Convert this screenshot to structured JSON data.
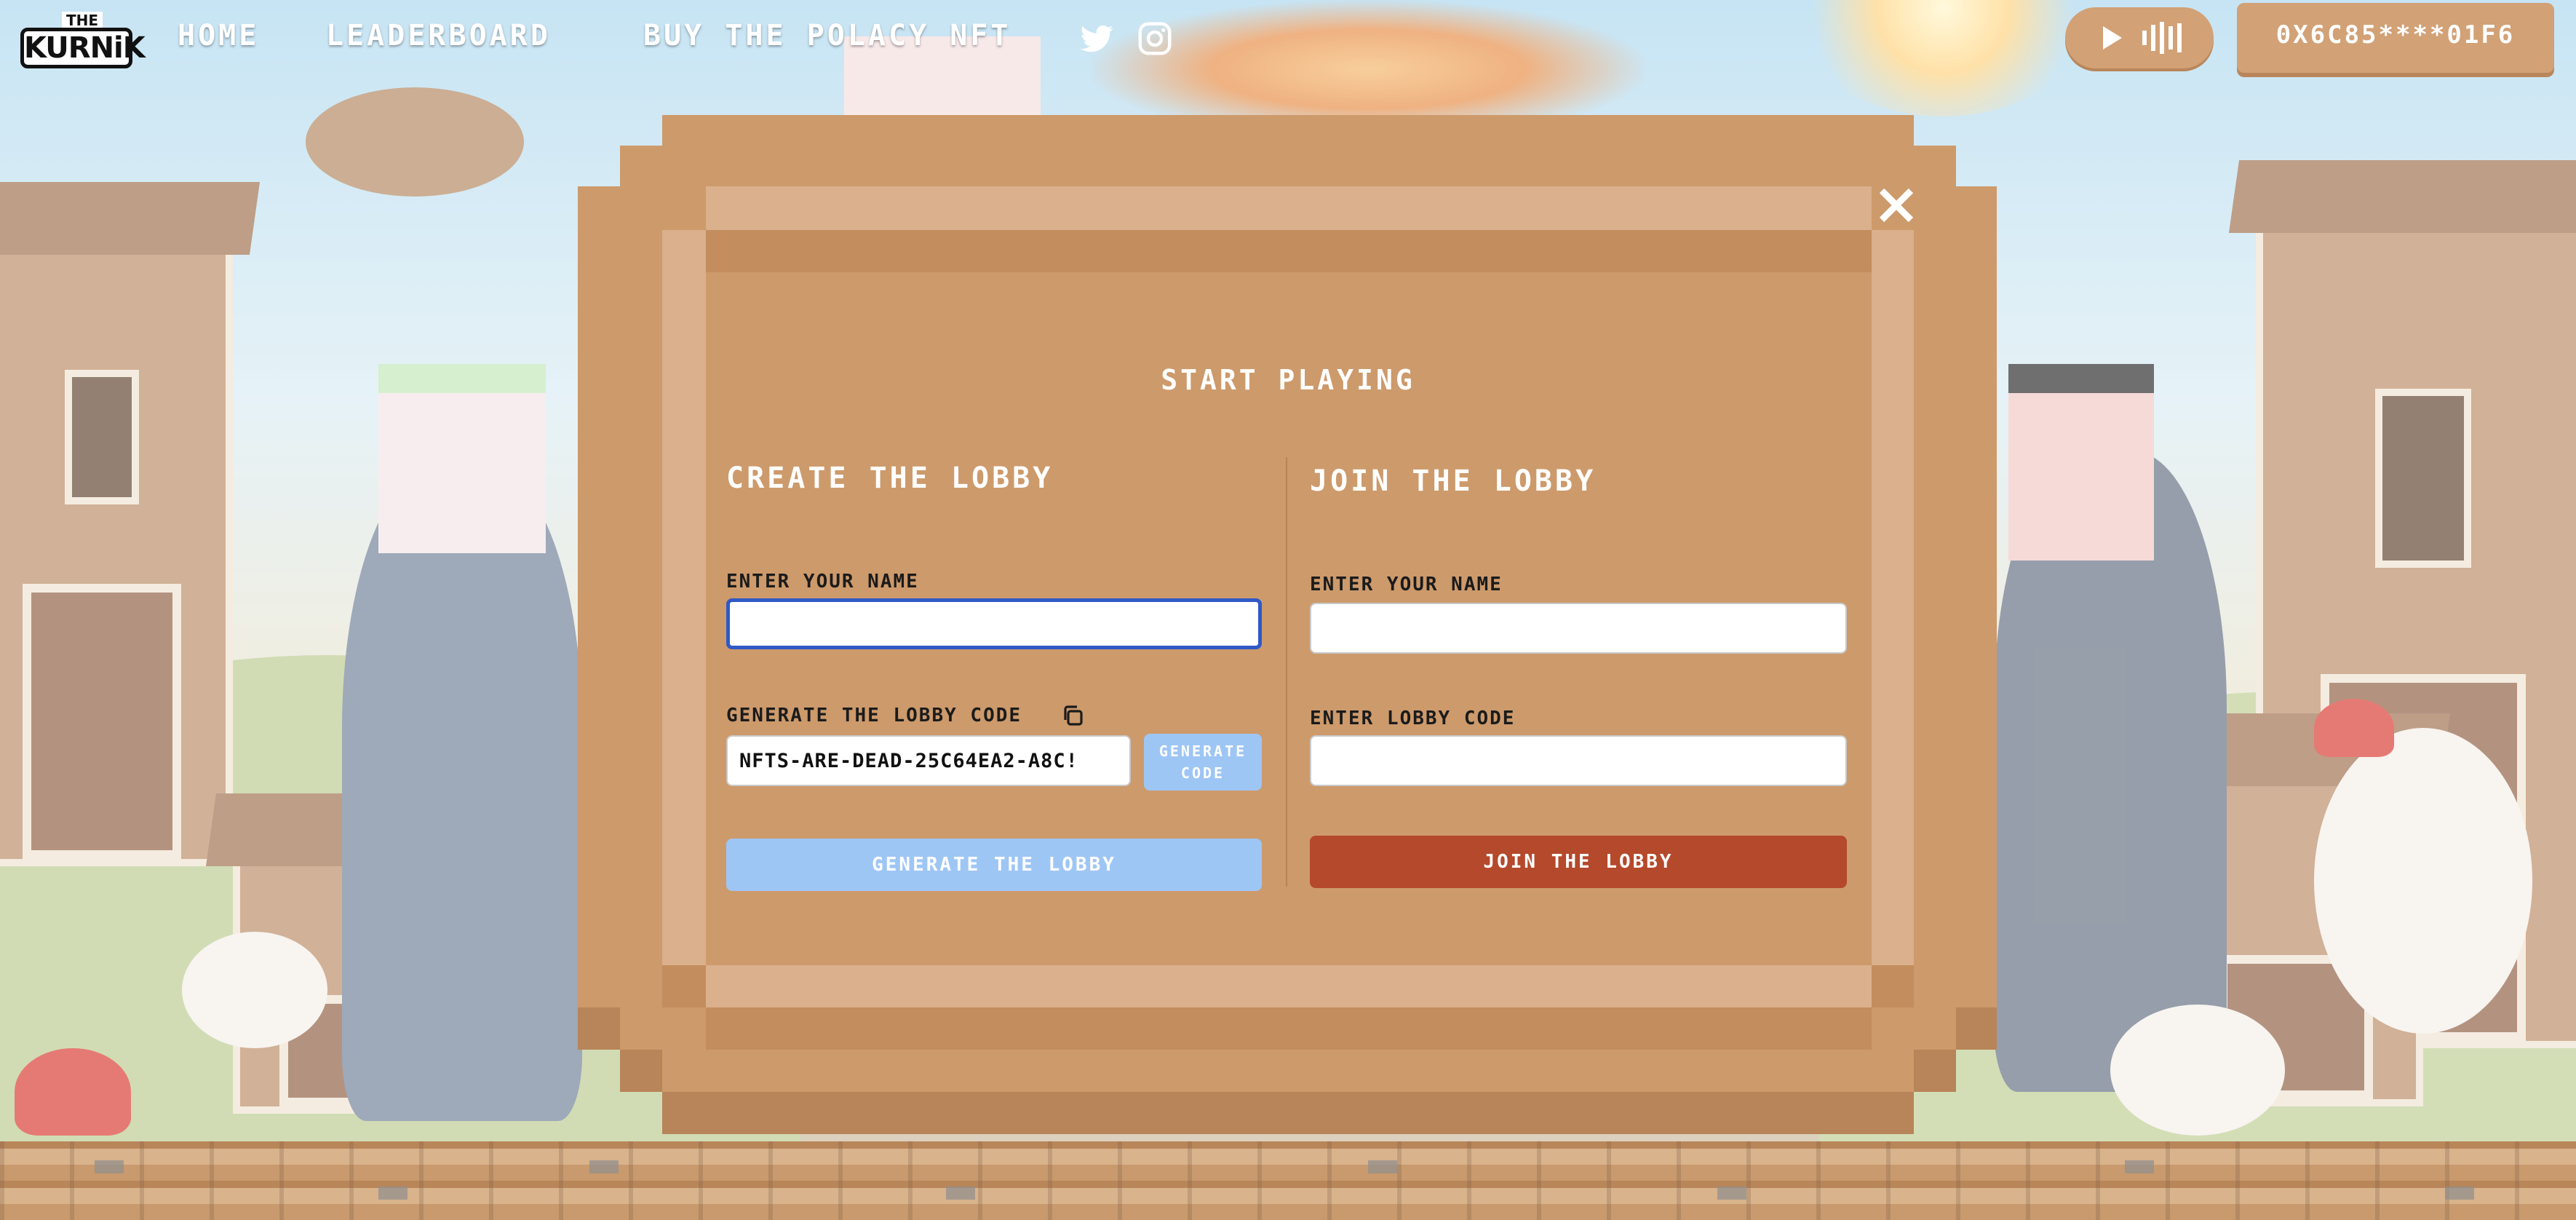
{
  "nav": {
    "logo_top": "THE",
    "logo_main": "KURNiK",
    "links": [
      "HOME",
      "LEADERBOARD",
      "BUY THE POLACY NFT"
    ],
    "social_icons": [
      "twitter-icon",
      "instagram-icon"
    ],
    "audio_icons": [
      "play-icon",
      "volume-bars-icon"
    ],
    "wallet_address": "0X6C85****01F6"
  },
  "modal": {
    "title": "START PLAYING",
    "close_icon": "close-icon",
    "create": {
      "heading": "CREATE THE LOBBY",
      "name_label": "ENTER YOUR NAME",
      "name_value": "",
      "code_label": "GENERATE THE LOBBY CODE",
      "copy_icon": "copy-icon",
      "code_value": "NFTS-ARE-DEAD-25C64EA2-A8C!",
      "generate_code_button_line1": "GENERATE",
      "generate_code_button_line2": "CODE",
      "generate_lobby_button": "GENERATE THE LOBBY"
    },
    "join": {
      "heading": "JOIN THE LOBBY",
      "name_label": "ENTER YOUR NAME",
      "name_value": "",
      "code_label": "ENTER LOBBY CODE",
      "code_value": "",
      "join_button": "JOIN THE LOBBY"
    }
  },
  "colors": {
    "frame": "#cd9a6b",
    "focus_border": "#2f59c6",
    "disabled_button": "#9ec6f5",
    "join_button": "#b5492b"
  }
}
